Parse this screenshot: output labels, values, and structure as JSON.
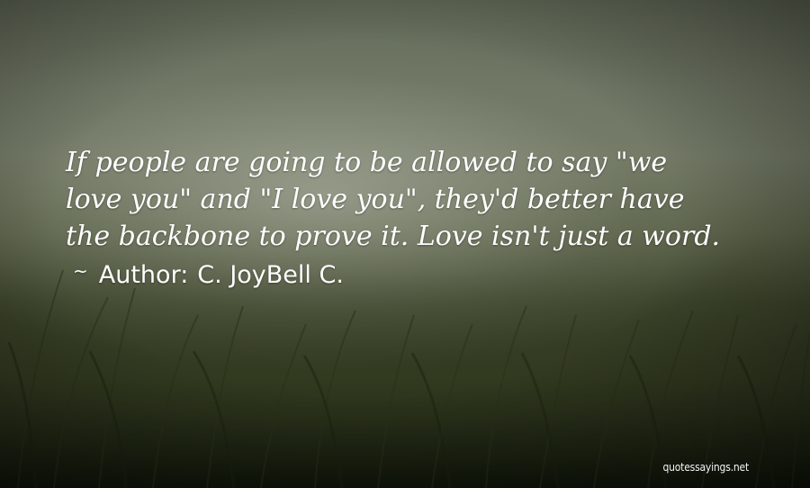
{
  "quote": {
    "text": "If people are going to be allowed to say \"we love you\" and \"I love you\", they'd better have the backbone to prove it. Love isn't just a word.",
    "lines": [
      "If people are going to be allowed to say \"we",
      "love you\" and \"I love you\", they'd better have",
      "the backbone to prove it. Love isn't just a word."
    ]
  },
  "author": {
    "separator": "~",
    "label": "Author:",
    "name": "C. JoyBell C."
  },
  "watermark": "quotessayings.net",
  "colors": {
    "text": "#ffffff",
    "sky": "#737a66",
    "field": "#232a16"
  }
}
